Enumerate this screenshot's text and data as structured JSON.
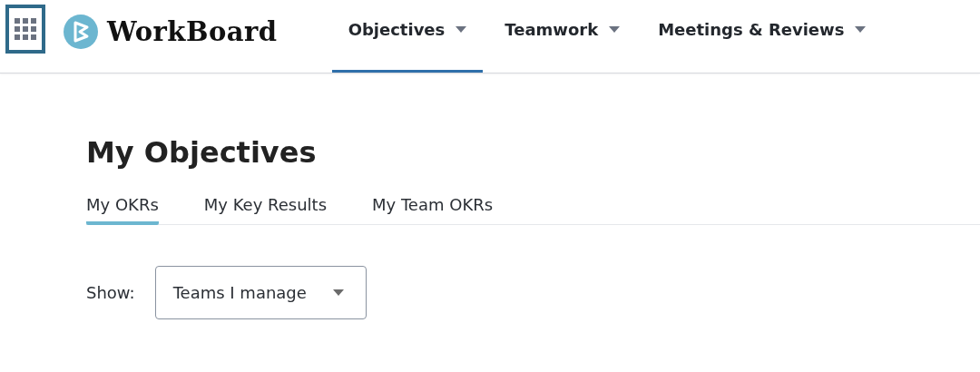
{
  "header": {
    "logo_text": "WorkBoard",
    "nav": [
      {
        "label": "Objectives",
        "selected": true
      },
      {
        "label": "Teamwork",
        "selected": false
      },
      {
        "label": "Meetings & Reviews",
        "selected": false
      }
    ]
  },
  "page": {
    "title": "My Objectives",
    "tabs": [
      {
        "label": "My OKRs",
        "selected": true
      },
      {
        "label": "My Key Results",
        "selected": false
      },
      {
        "label": "My Team OKRs",
        "selected": false
      }
    ],
    "filter": {
      "label": "Show:",
      "value": "Teams I manage"
    }
  }
}
